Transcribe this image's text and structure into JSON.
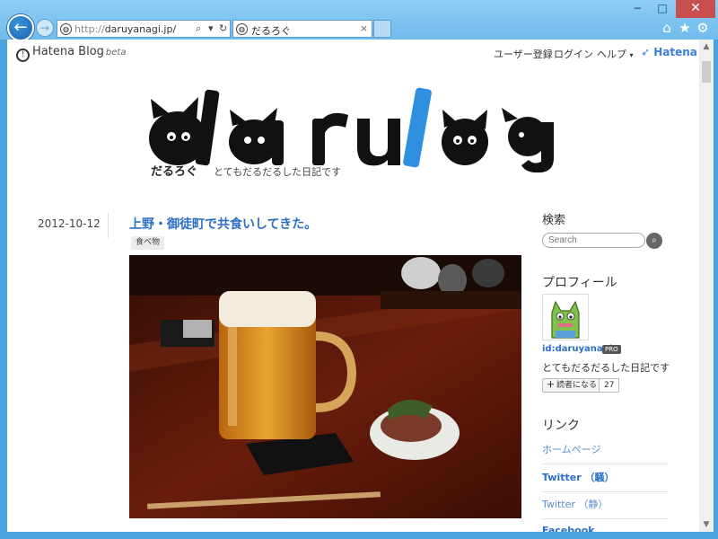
{
  "browser": {
    "url_prefix": "http://",
    "url_host": "daruyanagi.jp/",
    "tab_title": "だるろぐ",
    "tab_close": "×",
    "back_glyph": "←",
    "forward_glyph": "→",
    "window": {
      "minimize": "−",
      "maximize": "□",
      "close": "✕"
    },
    "toolbar_icons": [
      "home-icon",
      "star-icon",
      "gear-icon"
    ],
    "accent": "#6fbbee"
  },
  "hatena_bar": {
    "logo": "Hatena Blog",
    "logo_badge": "beta",
    "register": "ユーザー登録",
    "login": "ログイン",
    "help": "ヘルプ",
    "hatena": "Hatena"
  },
  "blog": {
    "logo_text": "darulog",
    "name_jp": "だるろぐ",
    "description": "とてもだるだるした日記です"
  },
  "entry": {
    "date": "2012-10-12",
    "title": "上野・御徒町で共食いしてきた。",
    "category": "食べ物"
  },
  "sidebar": {
    "search_heading": "検索",
    "search_placeholder": "Search",
    "profile_heading": "プロフィール",
    "user_id": "id:daruyanagi",
    "pro_badge": "PRO",
    "profile_desc": "とてもだるだるした日記です",
    "reader_button": "読者になる",
    "reader_count": "27",
    "links_heading": "リンク",
    "links": [
      "ホームページ",
      "Twitter （騒）",
      "Twitter （静）",
      "Facebook"
    ]
  },
  "colors": {
    "link_blue": "#2b6fc4",
    "title_blue": "#2b6fc4",
    "logo_accent": "#2f8fe0"
  }
}
